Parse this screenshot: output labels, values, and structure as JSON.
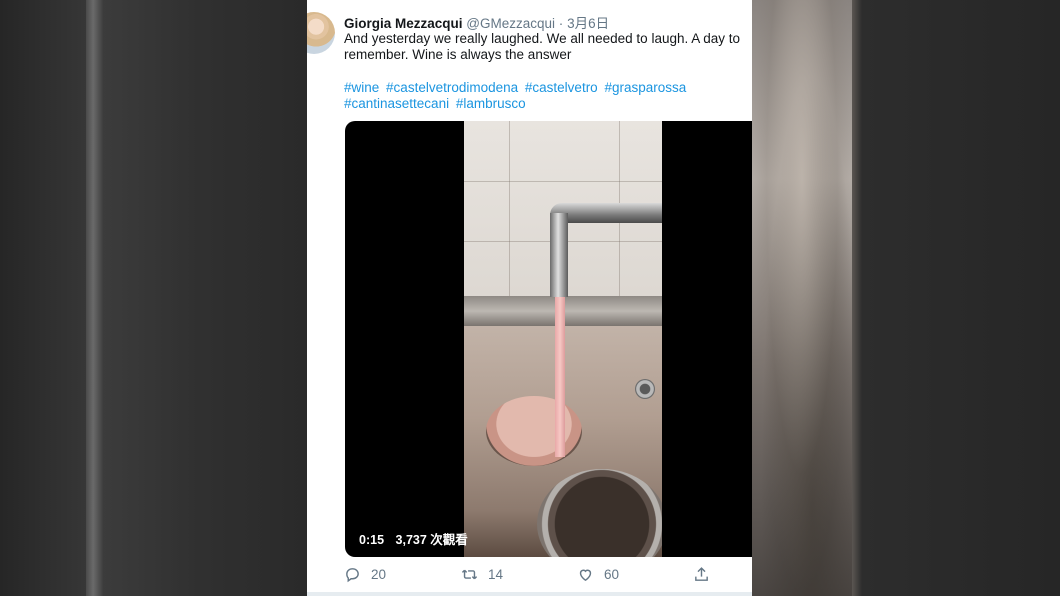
{
  "tweet": {
    "author_name": "Giorgia Mezzacqui",
    "author_handle": "@GMezzacqui",
    "separator": "·",
    "date": "3月6日",
    "text": "And yesterday we really laughed. We all needed to laugh. A day to remember. Wine is always the answer",
    "hashtags": [
      "#wine",
      "#castelvetrodimodena",
      "#castelvetro",
      "#grasparossa",
      "#cantinasettecani",
      "#lambrusco"
    ]
  },
  "video": {
    "duration": "0:15",
    "views": "3,737 次觀看"
  },
  "actions": {
    "reply": {
      "icon": "reply-icon",
      "count": "20"
    },
    "retweet": {
      "icon": "retweet-icon",
      "count": "14"
    },
    "like": {
      "icon": "heart-icon",
      "count": "60"
    },
    "share": {
      "icon": "share-icon"
    }
  },
  "colors": {
    "link": "#1b95e0",
    "secondary_text": "#657786",
    "primary_text": "#14171a"
  }
}
